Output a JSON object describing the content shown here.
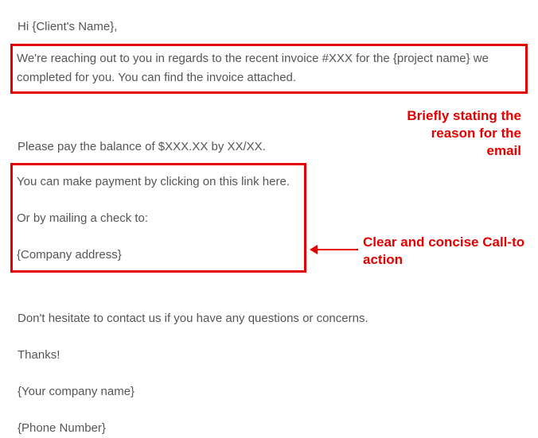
{
  "email": {
    "greeting": "Hi {Client's Name},",
    "intro": "We're reaching out to you in regards to the recent invoice #XXX for the {project name} we completed for you. You can find the invoice attached.",
    "balance": "Please pay the balance of $XXX.XX by XX/XX.",
    "payment_link": "You can make payment by clicking on this link here.",
    "mailing_intro": "Or by mailing a check to:",
    "company_address": "{Company address}",
    "contact": "Don't hesitate to contact us if you have any questions or concerns.",
    "thanks": "Thanks!",
    "company_name": "{Your company name}",
    "phone": "{Phone Number}"
  },
  "annotations": {
    "reason": "Briefly stating the reason for the email",
    "cta": "Clear and concise Call-to action"
  }
}
